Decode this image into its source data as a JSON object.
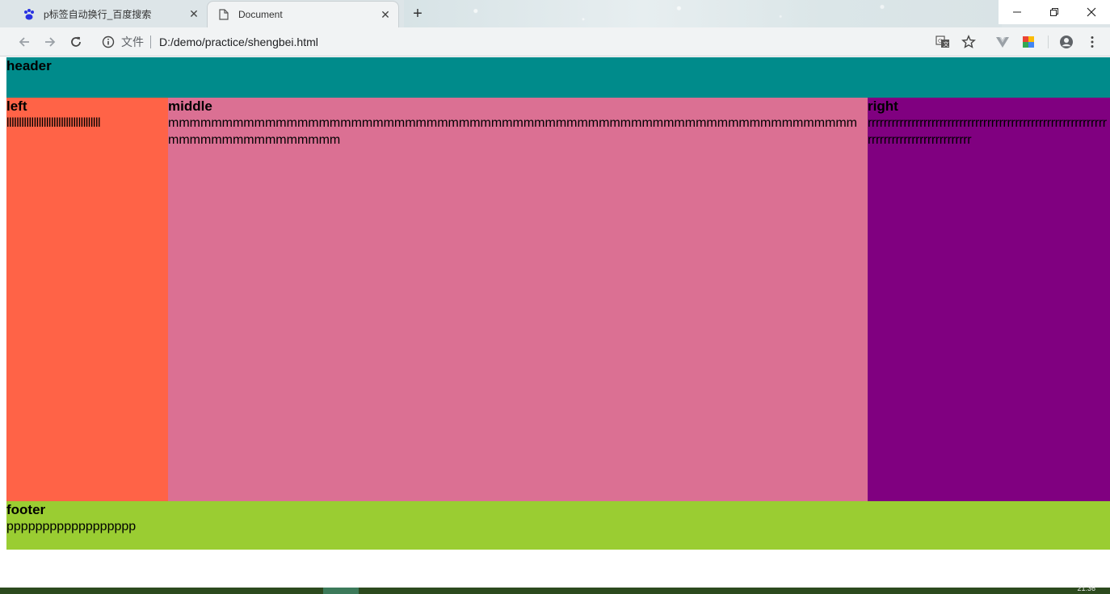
{
  "browser": {
    "tabs": [
      {
        "title": "p标签自动换行_百度搜索",
        "favicon": "baidu-paw-icon",
        "active": false
      },
      {
        "title": "Document",
        "favicon": "document-icon",
        "active": true
      }
    ],
    "address_bar": {
      "security_label": "文件",
      "url": "D:/demo/practice/shengbei.html"
    }
  },
  "page": {
    "header": {
      "title": "header",
      "color": "#008b8b"
    },
    "left": {
      "title": "left",
      "text": "llllllllllllllllllllllllllllllllllllll",
      "color": "#ff6347"
    },
    "middle": {
      "title": "middle",
      "text": "mmmmmmmmmmmmmmmmmmmmmmmmmmmmmmmmmmmmmmmmmmmmmmmmmmmmmmmmmmmmmmmmmmmmmmmmmmmmmmmm",
      "color": "#db7093"
    },
    "right": {
      "title": "right",
      "text": "rrrrrrrrrrrrrrrrrrrrrrrrrrrrrrrrrrrrrrrrrrrrrrrrrrrrrrrrrrrrrrrrrrrrrrrrrrrrrrrrrrrrrr",
      "color": "#800080"
    },
    "footer": {
      "title": "footer",
      "text": "pppppppppppppppppp",
      "color": "#9acd32"
    }
  },
  "taskbar": {
    "clock": "21:36"
  }
}
